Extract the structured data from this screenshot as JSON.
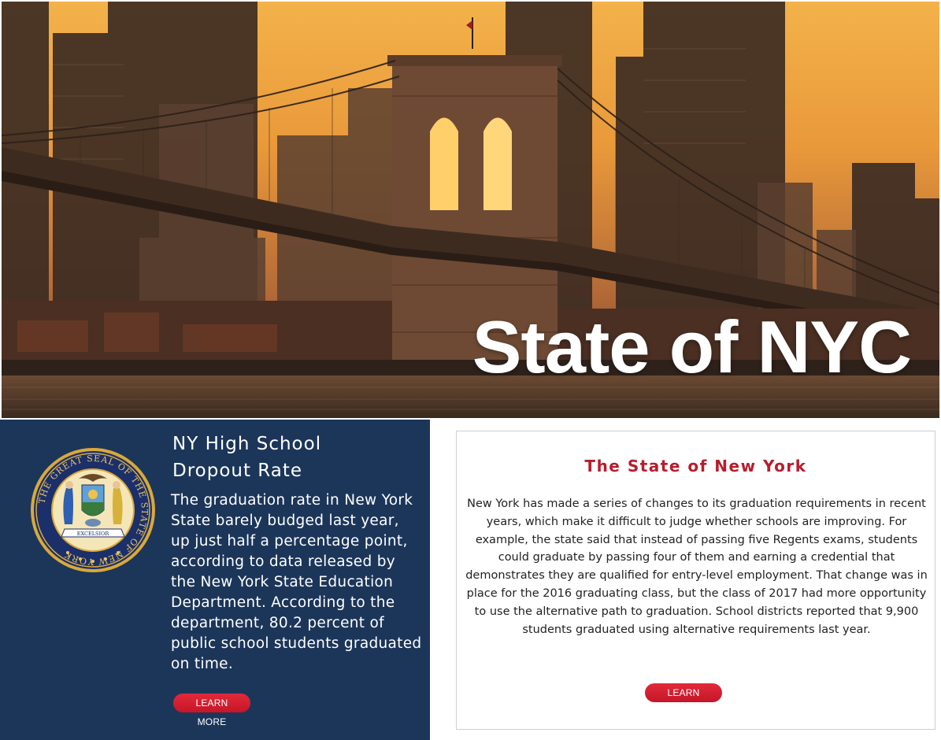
{
  "hero": {
    "title": "State of NYC"
  },
  "left_panel": {
    "heading_line1": "NY High School",
    "heading_line2": "Dropout Rate",
    "body": "The graduation rate in New York State barely budged last year, up just half a percentage point, according to data released by the New York State Education Department. According to the department, 80.2 percent of public school students graduated on time.",
    "button_label": "LEARN MORE",
    "seal": {
      "ring_text": "THE GREAT SEAL OF THE STATE OF NEW YORK",
      "banner_text": "EXCELSIOR"
    }
  },
  "right_card": {
    "heading": "The State of New York",
    "body": "New York has made a series of changes to its graduation requirements in recent years, which make it difficult to judge whether schools are improving. For example, the state said that instead of passing five Regents exams, students could graduate by passing four of them and earning a credential that demonstrates they are qualified for entry-level employment. That change was in place for the 2016 graduating class, but the class of 2017 had more opportunity to use the alternative path to graduation. School districts reported that 9,900 students graduated using alternative requirements last year.",
    "button_label": "LEARN MORE"
  },
  "colors": {
    "panel_navy": "#1c365a",
    "accent_red": "#b81d2c",
    "button_red": "#d11f31"
  }
}
